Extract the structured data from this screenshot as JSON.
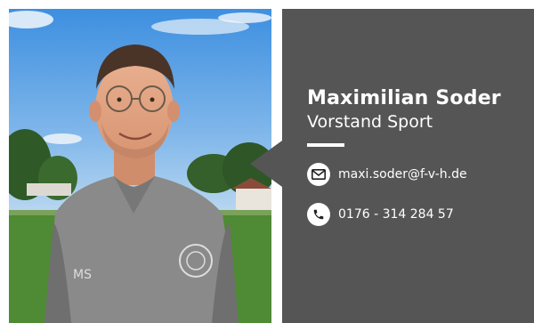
{
  "profile": {
    "name": "Maximilian Soder",
    "role": "Vorstand Sport",
    "shirt_initials": "MS"
  },
  "contacts": {
    "email": {
      "icon": "envelope-icon",
      "text": "maxi.soder@f-v-h.de"
    },
    "phone": {
      "icon": "phone-icon",
      "text": "0176 - 314 284 57"
    }
  },
  "colors": {
    "card_background": "#555555",
    "text": "#ffffff",
    "icon_circle": "#ffffff",
    "icon_glyph": "#222222"
  }
}
